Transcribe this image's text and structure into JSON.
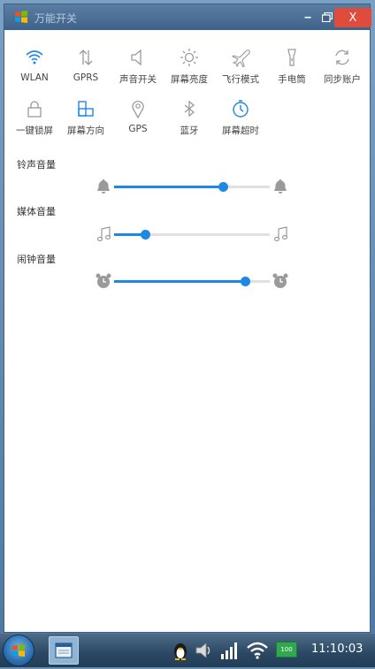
{
  "window": {
    "title": "万能开关",
    "minimize_glyph": "‒",
    "maximize_glyph": "▭",
    "close_glyph": "X"
  },
  "toggles": [
    {
      "label": "WLAN",
      "icon": "wifi-icon",
      "active": true
    },
    {
      "label": "GPRS",
      "icon": "data-arrows-icon",
      "active": false
    },
    {
      "label": "声音开关",
      "icon": "speaker-icon",
      "active": false
    },
    {
      "label": "屏幕亮度",
      "icon": "brightness-icon",
      "active": false
    },
    {
      "label": "飞行模式",
      "icon": "airplane-icon",
      "active": false
    },
    {
      "label": "手电筒",
      "icon": "flashlight-icon",
      "active": false
    },
    {
      "label": "同步账户",
      "icon": "sync-icon",
      "active": false
    },
    {
      "label": "一键锁屏",
      "icon": "lock-icon",
      "active": false
    },
    {
      "label": "屏幕方向",
      "icon": "rotate-icon",
      "active": true
    },
    {
      "label": "GPS",
      "icon": "location-icon",
      "active": false
    },
    {
      "label": "蓝牙",
      "icon": "bluetooth-icon",
      "active": false
    },
    {
      "label": "屏幕超时",
      "icon": "timer-icon",
      "active": true
    }
  ],
  "volumes": [
    {
      "label": "铃声音量",
      "icon": "bell-icon",
      "level": 0.7
    },
    {
      "label": "媒体音量",
      "icon": "music-note-icon",
      "level": 0.2
    },
    {
      "label": "闹钟音量",
      "icon": "alarm-clock-icon",
      "level": 0.84
    }
  ],
  "taskbar": {
    "battery": "100",
    "clock": "11:10:03"
  },
  "colors": {
    "accent": "#1e88e5",
    "icon_inactive": "#9a9a9a",
    "close_button": "#e04c3c"
  }
}
